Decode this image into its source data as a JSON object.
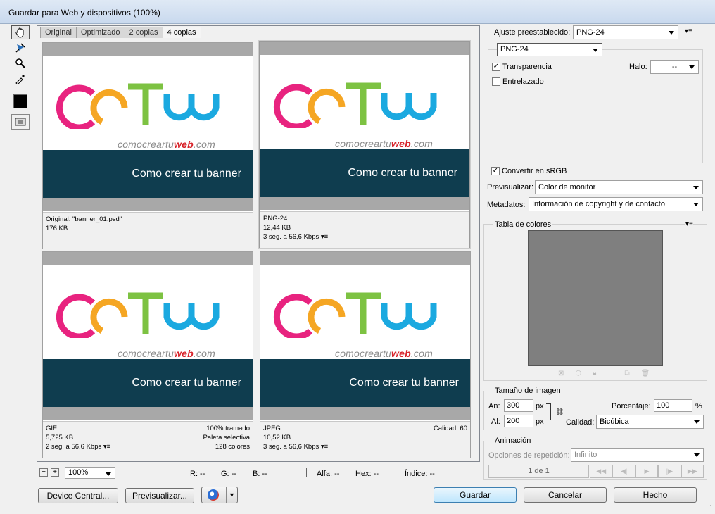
{
  "window": {
    "title": "Guardar para Web y dispositivos (100%)"
  },
  "tabs": [
    "Original",
    "Optimizado",
    "2 copias",
    "4 copias"
  ],
  "panes": [
    {
      "line1": "Original: \"banner_01.psd\"",
      "line2": "176 KB",
      "line3": "",
      "r1": "",
      "r2": "",
      "r3": ""
    },
    {
      "line1": "PNG-24",
      "line2": "12,44 KB",
      "line3": "3 seg. a 56,6 Kbps",
      "r1": "",
      "r2": "",
      "r3": ""
    },
    {
      "line1": "GIF",
      "line2": "5,725 KB",
      "line3": "2 seg. a 56,6 Kbps",
      "r1": "100% tramado",
      "r2": "Paleta selectiva",
      "r3": "128 colores"
    },
    {
      "line1": "JPEG",
      "line2": "10,52 KB",
      "line3": "3 seg. a 56,6 Kbps",
      "r1": "Calidad: 60",
      "r2": "",
      "r3": ""
    }
  ],
  "banner": {
    "site_prefix": "comocrear",
    "site_tu": "tu",
    "site_web": "web",
    ".com": ".com",
    "site_suffix": ".com",
    "caption": "Como crear tu banner"
  },
  "status": {
    "zoom": "100%",
    "r": "R: --",
    "g": "G: --",
    "b": "B: --",
    "alpha": "Alfa: --",
    "hex": "Hex: --",
    "index": "Índice: --"
  },
  "buttons": {
    "device_central": "Device Central...",
    "preview": "Previsualizar...",
    "save": "Guardar",
    "cancel": "Cancelar",
    "done": "Hecho"
  },
  "settings": {
    "preset_label": "Ajuste preestablecido:",
    "preset": "PNG-24",
    "format": "PNG-24",
    "transparency": "Transparencia",
    "halo_label": "Halo:",
    "halo": "--",
    "interlaced": "Entrelazado",
    "convert_srgb": "Convertir en sRGB",
    "preview_label": "Previsualizar:",
    "preview_value": "Color de monitor",
    "metadata_label": "Metadatos:",
    "metadata_value": "Información de copyright y de contacto"
  },
  "color_table": {
    "title": "Tabla de colores"
  },
  "image_size": {
    "title": "Tamaño de imagen",
    "w_label": "An:",
    "w": "300",
    "h_label": "Al:",
    "h": "200",
    "unit": "px",
    "pct_label": "Porcentaje:",
    "pct": "100",
    "pct_unit": "%",
    "quality_label": "Calidad:",
    "quality": "Bicúbica"
  },
  "animation": {
    "title": "Animación",
    "loop_label": "Opciones de repetición:",
    "loop": "Infinito",
    "frame": "1 de 1"
  },
  "colors": {
    "pink": "#e8237f",
    "orange": "#f5a623",
    "green": "#7dc242",
    "blue": "#1ba9e0",
    "banner_bg": "#0f3d4f"
  }
}
